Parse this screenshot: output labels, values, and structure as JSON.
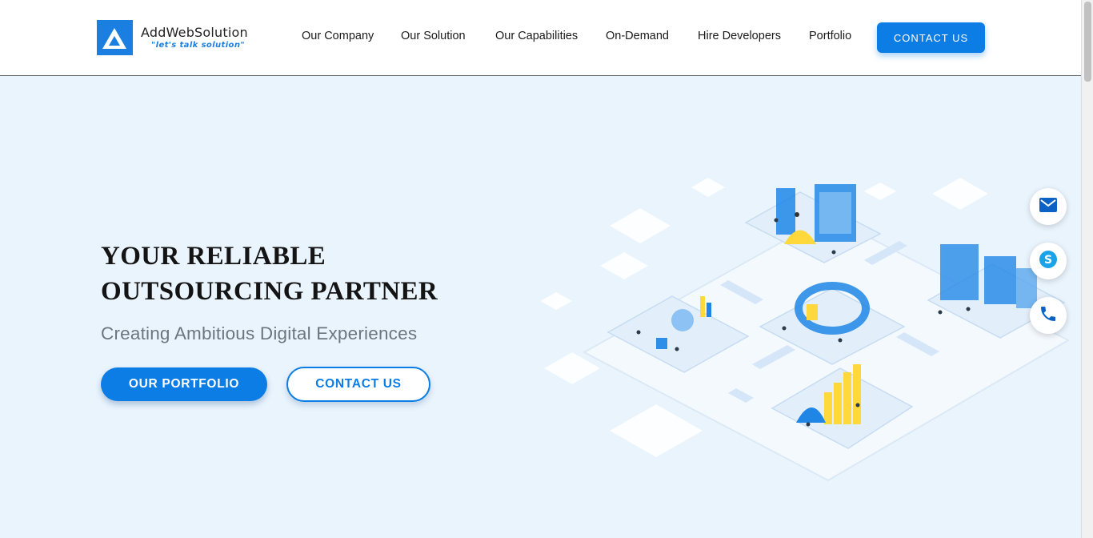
{
  "brand": {
    "name": "AddWebSolution",
    "tagline": "\"let's talk solution\"",
    "logo_icon": "logo-triangle-icon",
    "color": "#1a7fe0"
  },
  "nav": {
    "items": [
      {
        "label": "Our Company"
      },
      {
        "label": "Our Solution"
      },
      {
        "label": "Our Capabilities"
      },
      {
        "label": "On-Demand"
      },
      {
        "label": "Hire Developers"
      },
      {
        "label": "Portfolio"
      }
    ],
    "contact_label": "CONTACT US"
  },
  "hero": {
    "title_line1": "YOUR RELIABLE",
    "title_line2": "OUTSOURCING PARTNER",
    "subtitle": "Creating Ambitious Digital Experiences",
    "primary_button": "OUR PORTFOLIO",
    "secondary_button": "CONTACT US",
    "illustration_icon": "isometric-data-city-illustration"
  },
  "floating_contacts": [
    {
      "icon": "mail-icon"
    },
    {
      "icon": "skype-icon"
    },
    {
      "icon": "phone-icon"
    }
  ],
  "colors": {
    "accent": "#0b7de5",
    "background": "#eaf4fd",
    "text_dark": "#141414",
    "text_muted": "#6b7680"
  }
}
